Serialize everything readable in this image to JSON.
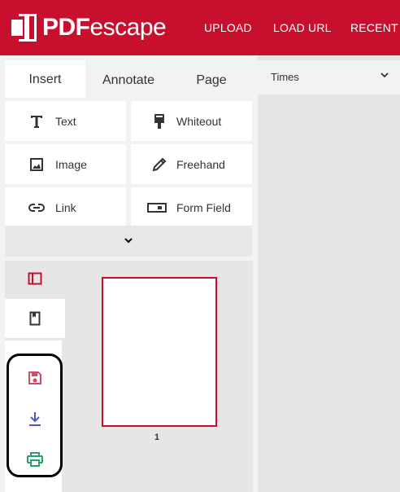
{
  "header": {
    "logo_text_a": "PDF",
    "logo_text_b": "escape",
    "nav": [
      "UPLOAD",
      "LOAD URL",
      "RECENT"
    ],
    "brand_color": "#c8102e"
  },
  "tabs": [
    {
      "label": "Insert",
      "active": true
    },
    {
      "label": "Annotate",
      "active": false
    },
    {
      "label": "Page",
      "active": false
    }
  ],
  "tools": [
    {
      "label": "Text",
      "icon": "text-icon"
    },
    {
      "label": "Whiteout",
      "icon": "whiteout-icon"
    },
    {
      "label": "Image",
      "icon": "image-icon"
    },
    {
      "label": "Freehand",
      "icon": "pencil-icon"
    },
    {
      "label": "Link",
      "icon": "link-icon"
    },
    {
      "label": "Form Field",
      "icon": "form-field-icon"
    }
  ],
  "font_select": {
    "value": "Times"
  },
  "thumbnails": [
    {
      "page": "1"
    }
  ],
  "sidebar": [
    {
      "icon": "page-view-icon"
    },
    {
      "icon": "bookmark-icon"
    },
    {
      "icon": "save-icon"
    },
    {
      "icon": "download-icon"
    },
    {
      "icon": "print-icon"
    }
  ]
}
